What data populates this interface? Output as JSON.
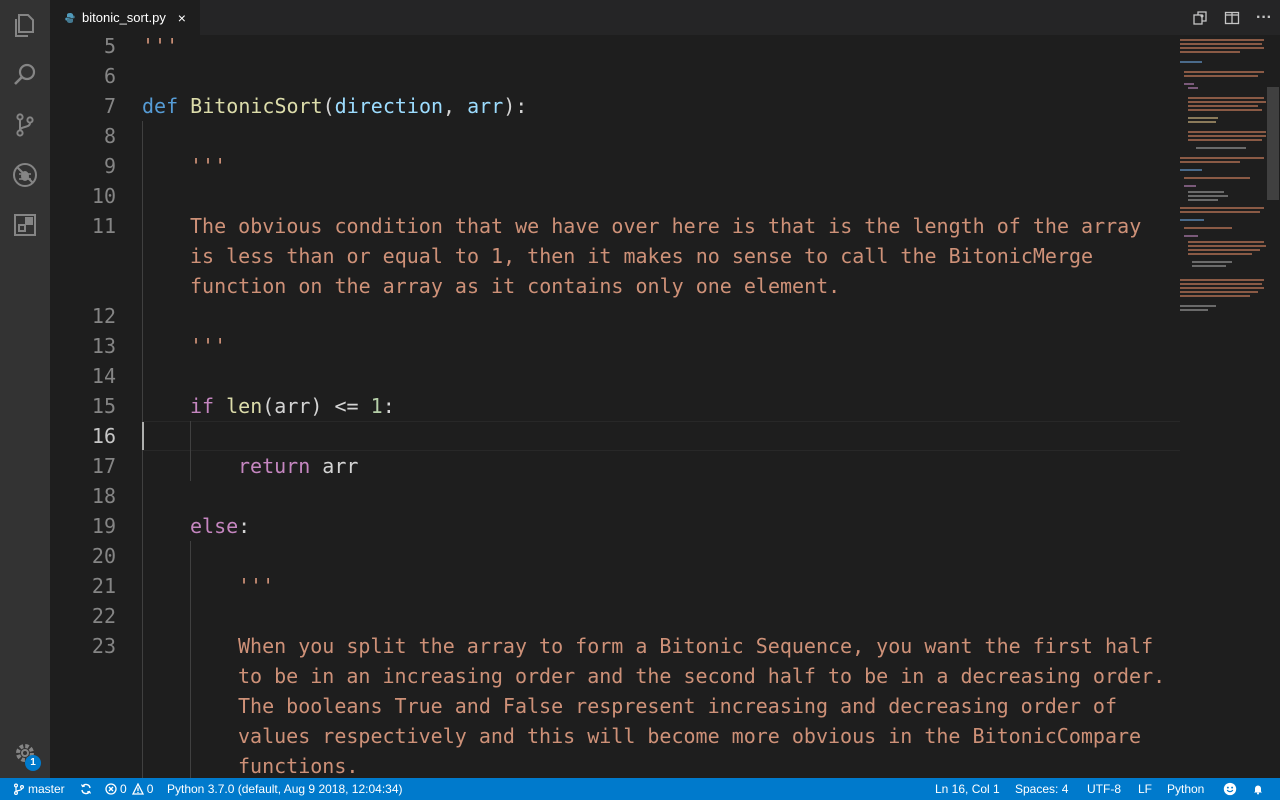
{
  "tab": {
    "filename": "bitonic_sort.py",
    "close_glyph": "×",
    "file_icon": "python-file-icon"
  },
  "activity_bar": {
    "items": [
      "explorer-icon",
      "search-icon",
      "source-control-icon",
      "debug-icon",
      "extensions-icon"
    ],
    "settings_badge": "1"
  },
  "title_actions": [
    "open-changes-icon",
    "split-editor-icon",
    "more-actions-icon"
  ],
  "title_actions_more": "···",
  "editor": {
    "line_numbers": [
      "5",
      "6",
      "7",
      "8",
      "9",
      "10",
      "11",
      "12",
      "13",
      "14",
      "15",
      "16",
      "17",
      "18",
      "19",
      "20",
      "21",
      "22",
      "23"
    ],
    "current_line": "16",
    "lines": {
      "l5": "'''",
      "l7_def": "def",
      "l7_name": "BitonicSort",
      "l7_paren_open": "(",
      "l7_p1": "direction",
      "l7_comma": ", ",
      "l7_p2": "arr",
      "l7_end": "):",
      "l9": "'''",
      "l11a": "The obvious condition that we have over here is that is the length of the array",
      "l11b": "is less than or equal to 1, then it makes no sense to call the BitonicMerge",
      "l11c": "function on the array as it contains only one element.",
      "l13": "'''",
      "l15_if": "if",
      "l15_len": "len",
      "l15_mid": "(arr) <= ",
      "l15_num": "1",
      "l15_colon": ":",
      "l17_return": "return",
      "l17_arr": " arr",
      "l19_else": "else",
      "l19_colon": ":",
      "l21": "'''",
      "l23a": "When you split the array to form a Bitonic Sequence, you want the first half",
      "l23b": "to be in an increasing order and the second half to be in a decreasing order.",
      "l23c": "The booleans True and False respresent increasing and decreasing order of",
      "l23d": "values respectively and this will become more obvious in the BitonicCompare",
      "l23e": "functions."
    }
  },
  "status_bar": {
    "branch": "master",
    "errors": "0",
    "warnings": "0",
    "interpreter": "Python 3.7.0 (default, Aug  9 2018, 12:04:34)",
    "cursor_position": "Ln 16, Col 1",
    "indentation": "Spaces: 4",
    "encoding": "UTF-8",
    "line_ending": "LF",
    "language": "Python"
  },
  "colors": {
    "status_bar_bg": "#007acc",
    "activity_bar_bg": "#333333",
    "editor_bg": "#1e1e1e",
    "keyword": "#569cd6",
    "control": "#c586c0",
    "function": "#dcdcaa",
    "parameter": "#9cdcfe",
    "string": "#ce9178",
    "number": "#b5cea8"
  }
}
